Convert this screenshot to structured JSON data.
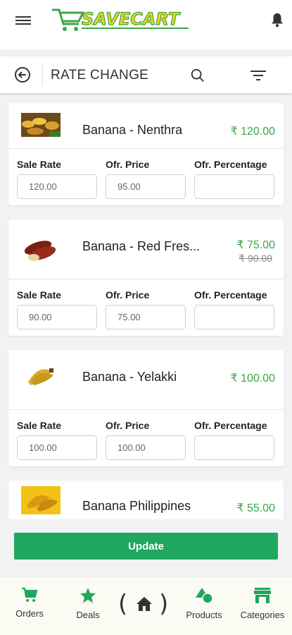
{
  "header": {
    "logo_text": "SAVECART"
  },
  "subheader": {
    "title": "RATE CHANGE"
  },
  "field_labels": {
    "sale_rate": "Sale Rate",
    "offer_price": "Ofr. Price",
    "offer_percentage": "Ofr. Percentage"
  },
  "products": [
    {
      "name": "Banana - Nenthra",
      "price": "₹ 120.00",
      "old_price": "",
      "sale_rate": "120.00",
      "offer_price": "95.00",
      "offer_percentage": ""
    },
    {
      "name": "Banana - Red Fres...",
      "price": "₹ 75.00",
      "old_price": "₹ 90.00",
      "sale_rate": "90.00",
      "offer_price": "75.00",
      "offer_percentage": ""
    },
    {
      "name": "Banana - Yelakki",
      "price": "₹ 100.00",
      "old_price": "",
      "sale_rate": "100.00",
      "offer_price": "100.00",
      "offer_percentage": ""
    },
    {
      "name": "Banana Philippines",
      "price": "₹ 55.00",
      "old_price": ""
    }
  ],
  "update_button": "Update",
  "bottom_nav": {
    "orders": "Orders",
    "deals": "Deals",
    "products": "Products",
    "categories": "Categories"
  },
  "colors": {
    "brand_green": "#1fa65f",
    "price_green": "#3aa847",
    "logo_yellow": "#f2d21b"
  }
}
